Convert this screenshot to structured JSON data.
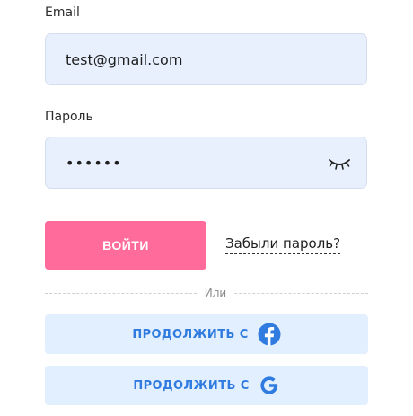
{
  "email": {
    "label": "Email",
    "value": "test@gmail.com"
  },
  "password": {
    "label": "Пароль",
    "value": "••••••",
    "icon": "eye-closed-icon"
  },
  "login_button": "ВОЙТИ",
  "forgot_link": "Забыли пароль?",
  "divider_text": "Или",
  "social": [
    {
      "label": "ПРОДОЛЖИТЬ С",
      "icon": "facebook-icon"
    },
    {
      "label": "ПРОДОЛЖИТЬ С",
      "icon": "google-icon"
    }
  ],
  "colors": {
    "accent": "#ff6b9a",
    "social_bg": "#e2efff",
    "social_text": "#2f7be0",
    "field_bg": "#e8f0fe"
  }
}
